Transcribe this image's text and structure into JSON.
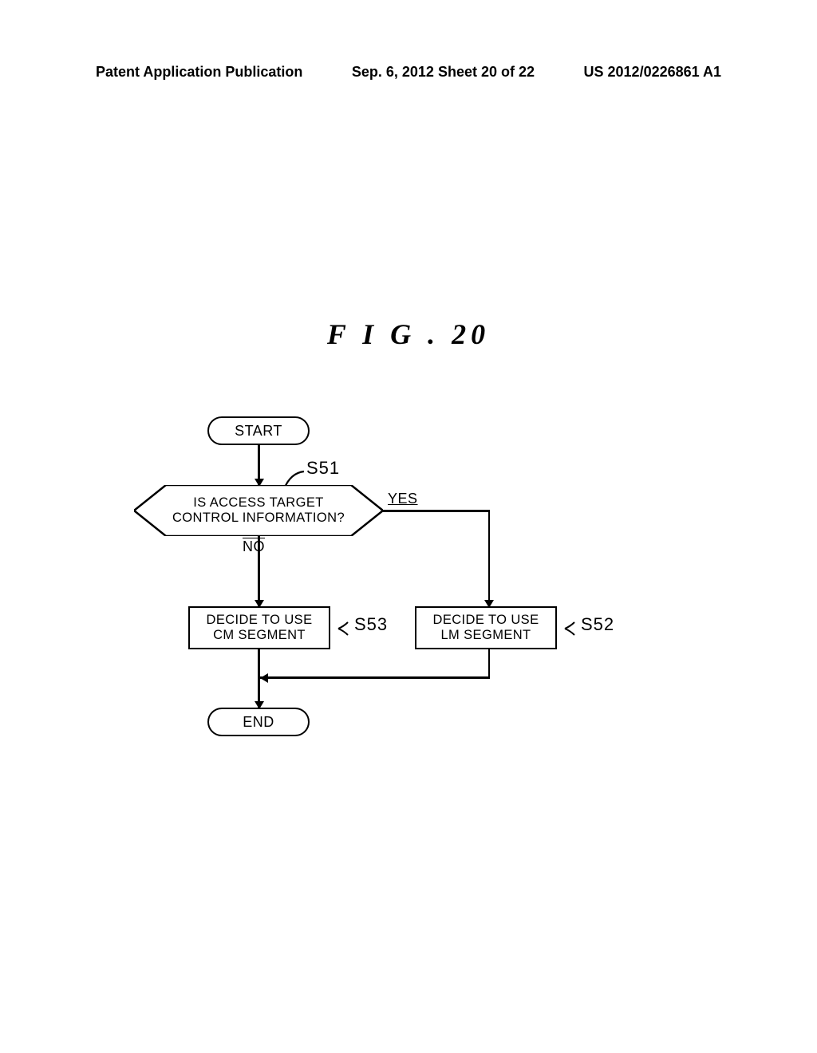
{
  "header": {
    "left": "Patent Application Publication",
    "center": "Sep. 6, 2012  Sheet 20 of 22",
    "right": "US 2012/0226861 A1"
  },
  "figure_title": "F I G . 20",
  "flow": {
    "start": "START",
    "end": "END",
    "decision": {
      "line1": "IS ACCESS TARGET",
      "line2": "CONTROL INFORMATION?",
      "yes": "YES",
      "no": "NO",
      "step": "S51"
    },
    "cm": {
      "line1": "DECIDE TO USE",
      "line2": "CM SEGMENT",
      "step": "S53"
    },
    "lm": {
      "line1": "DECIDE TO USE",
      "line2": "LM SEGMENT",
      "step": "S52"
    }
  }
}
